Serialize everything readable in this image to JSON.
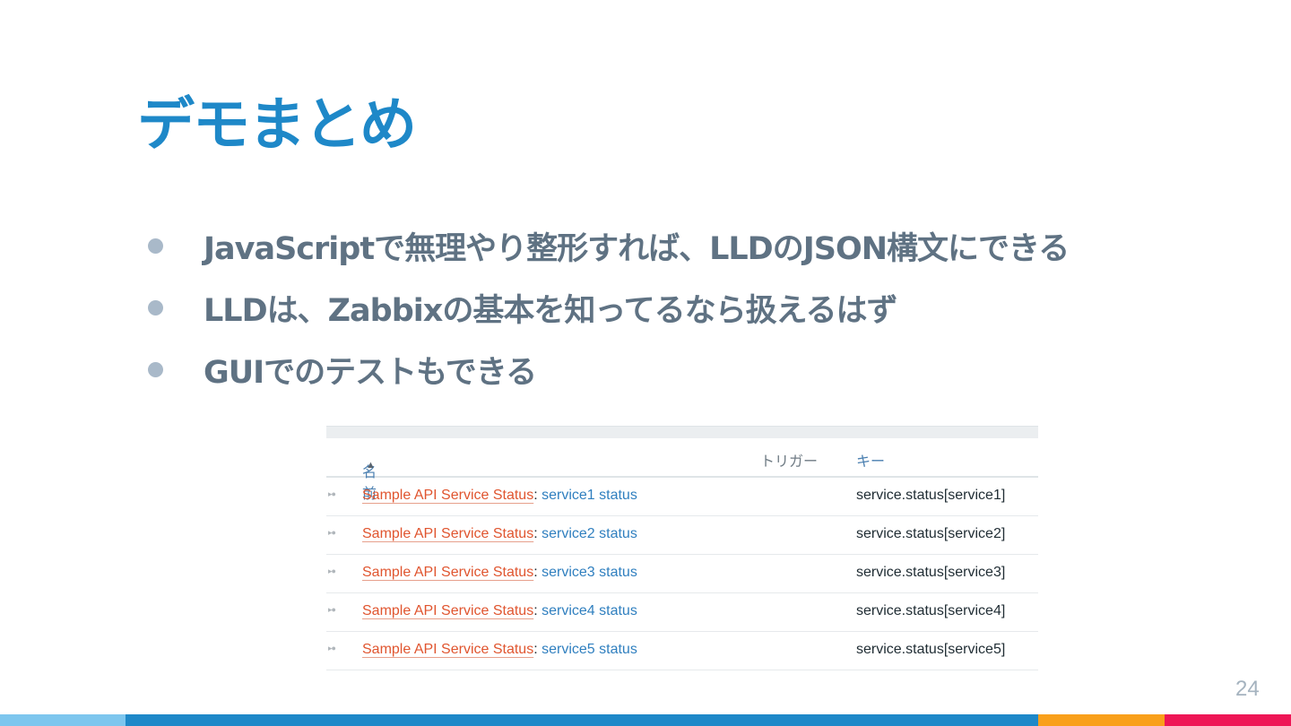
{
  "slide": {
    "title": "デモまとめ",
    "bullets": [
      "JavaScriptで無理やり整形すれば、LLDのJSON構文にできる",
      "LLDは、Zabbixの基本を知ってるなら扱えるはず",
      "GUIでのテストもできる"
    ],
    "page_number": "24"
  },
  "table": {
    "columns": {
      "name": "名前",
      "sort_indicator": "▲",
      "triggers": "トリガー",
      "key": "キー"
    },
    "rows": [
      {
        "host": "Sample API Service Status",
        "item": "service1 status",
        "key": "service.status[service1]"
      },
      {
        "host": "Sample API Service Status",
        "item": "service2 status",
        "key": "service.status[service2]"
      },
      {
        "host": "Sample API Service Status",
        "item": "service3 status",
        "key": "service.status[service3]"
      },
      {
        "host": "Sample API Service Status",
        "item": "service4 status",
        "key": "service.status[service4]"
      },
      {
        "host": "Sample API Service Status",
        "item": "service5 status",
        "key": "service.status[service5]"
      }
    ],
    "separator": ":",
    "drag_handle_icon": "drag-handle-icon"
  },
  "colors": {
    "title": "#1e88c8",
    "bullet_text": "#5f7283",
    "host_link": "#e0552f",
    "item_link": "#2f7fbf",
    "band": [
      "#7dc6ee",
      "#1e88c8",
      "#f9a01b",
      "#ee1656"
    ]
  }
}
